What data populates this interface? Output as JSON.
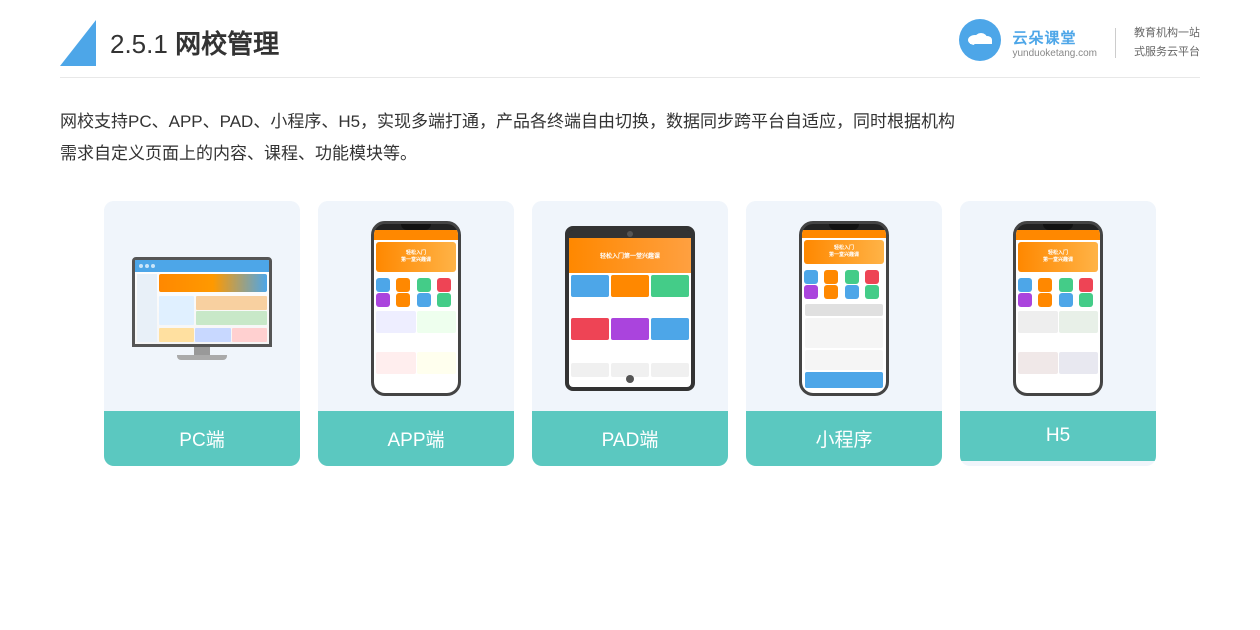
{
  "header": {
    "title_prefix": "2.5.1 ",
    "title_main": "网校管理",
    "logo_site": "yunduoketang.com",
    "logo_slogan_line1": "教育机构一站",
    "logo_slogan_line2": "式服务云平台"
  },
  "description": {
    "text_line1": "网校支持PC、APP、PAD、小程序、H5，实现多端打通，产品各终端自由切换，数据同步跨平台自适应，同时根据机构",
    "text_line2": "需求自定义页面上的内容、课程、功能模块等。"
  },
  "cards": [
    {
      "id": "pc",
      "label": "PC端"
    },
    {
      "id": "app",
      "label": "APP端"
    },
    {
      "id": "pad",
      "label": "PAD端"
    },
    {
      "id": "miniapp",
      "label": "小程序"
    },
    {
      "id": "h5",
      "label": "H5"
    }
  ],
  "colors": {
    "card_label_bg": "#5bc8c0",
    "card_bg": "#eef3f9",
    "accent_blue": "#4da6e8",
    "accent_orange": "#ff8c00"
  }
}
